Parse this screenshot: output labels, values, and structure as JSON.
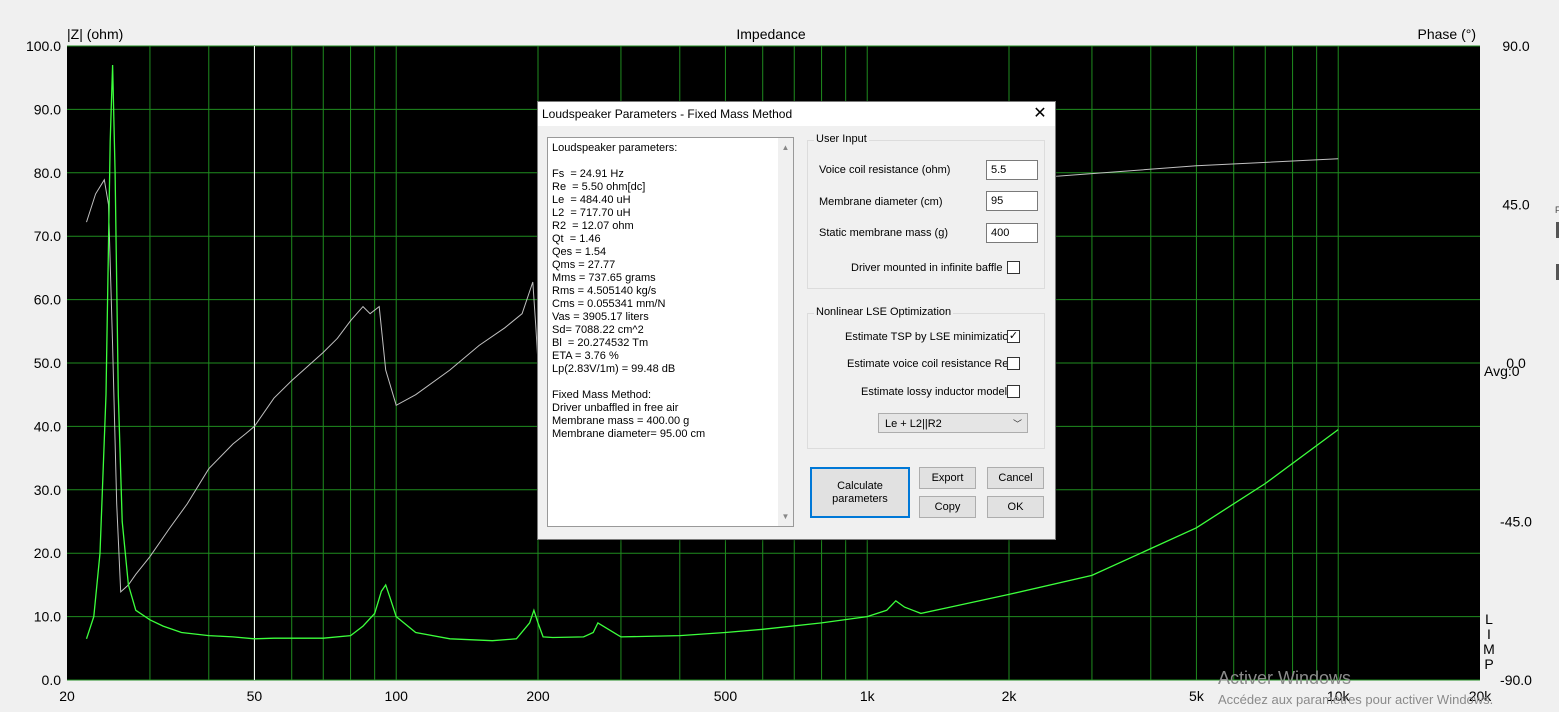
{
  "plot": {
    "title": "Impedance",
    "left_axis_label": "|Z| (ohm)",
    "right_axis_label": "Phase (°)",
    "avg_label": "Avg:0",
    "limp_label": "LIMP",
    "y_left_ticks": [
      "100.0",
      "90.0",
      "80.0",
      "70.0",
      "60.0",
      "50.0",
      "40.0",
      "30.0",
      "20.0",
      "10.0",
      "0.0"
    ],
    "y_right_ticks": [
      "90.0",
      "45.0",
      "0.0",
      "-45.0",
      "-90.0"
    ],
    "x_ticks": [
      "20",
      "50",
      "100",
      "200",
      "500",
      "1k",
      "2k",
      "5k",
      "10k",
      "20k"
    ],
    "colors": {
      "background": "#000000",
      "grid": "#1f8c1f",
      "impedance": "#3cff3c",
      "phase": "#c0c0c0",
      "cursor": "#ffffff"
    }
  },
  "chart_data": {
    "type": "line",
    "title": "Impedance",
    "xscale": "log",
    "xlim": [
      20,
      20000
    ],
    "ylim_left": [
      0,
      100
    ],
    "ylim_right": [
      -90,
      90
    ],
    "xlabel": "",
    "ylabel": "|Z| (ohm)",
    "ylabel_right": "Phase (°)",
    "grid": true,
    "series": [
      {
        "name": "|Z| (ohm)",
        "axis": "left",
        "color": "#3cff3c",
        "x": [
          22,
          22.8,
          23.5,
          24.2,
          24.7,
          25.0,
          25.3,
          25.7,
          26.2,
          27,
          28,
          30,
          32,
          35,
          40,
          45,
          50,
          55,
          60,
          70,
          80,
          85,
          90,
          93,
          95,
          97,
          100,
          110,
          130,
          160,
          180,
          192,
          196,
          200,
          205,
          215,
          250,
          262,
          268,
          300,
          400,
          500,
          600,
          800,
          1000,
          1100,
          1150,
          1200,
          1250,
          1300,
          1500,
          2000,
          3000,
          5000,
          7000,
          10000
        ],
        "y": [
          6.5,
          10,
          20,
          45,
          85,
          97,
          80,
          45,
          25,
          15,
          11,
          9.5,
          8.5,
          7.5,
          7,
          6.8,
          6.5,
          6.6,
          6.6,
          6.6,
          7,
          8.5,
          10.5,
          14,
          15,
          13,
          10,
          7.5,
          6.5,
          6.2,
          6.5,
          9,
          11,
          9,
          6.8,
          6.7,
          6.8,
          7.5,
          9,
          6.8,
          7,
          7.5,
          8,
          9,
          10,
          11,
          12.5,
          11.5,
          11,
          10.5,
          11.5,
          13.5,
          16.5,
          24,
          31,
          39.5
        ]
      },
      {
        "name": "Phase (°)",
        "axis": "right",
        "color": "#c0c0c0",
        "x": [
          22,
          23,
          24,
          24.5,
          25.0,
          25.5,
          26,
          27,
          28,
          30,
          33,
          36,
          40,
          45,
          48,
          50,
          55,
          60,
          70,
          75,
          80,
          85,
          88,
          92,
          95,
          100,
          110,
          130,
          150,
          170,
          185,
          195,
          198,
          200,
          220,
          300,
          500,
          800,
          1000,
          2000,
          5000,
          10000
        ],
        "y": [
          40,
          48,
          52,
          45,
          5,
          -40,
          -65,
          -63,
          -60,
          -55,
          -47,
          -40,
          -30,
          -23,
          -20,
          -18,
          -10,
          -5,
          3,
          7,
          12,
          16,
          14,
          16,
          -2,
          -12,
          -9,
          -2,
          5,
          10,
          14,
          23,
          10,
          0,
          -5,
          5,
          20,
          35,
          45,
          52,
          56,
          58
        ]
      }
    ],
    "cursor_x": 50
  },
  "dialog": {
    "title": "Loudspeaker Parameters - Fixed Mass Method",
    "close_label": "✕",
    "results_text": "Loudspeaker parameters:\n\nFs  = 24.91 Hz\nRe  = 5.50 ohm[dc]\nLe  = 484.40 uH\nL2  = 717.70 uH\nR2  = 12.07 ohm\nQt  = 1.46\nQes = 1.54\nQms = 27.77\nMms = 737.65 grams\nRms = 4.505140 kg/s\nCms = 0.055341 mm/N\nVas = 3905.17 liters\nSd= 7088.22 cm^2\nBl  = 20.274532 Tm\nETA = 3.76 %\nLp(2.83V/1m) = 99.48 dB\n\nFixed Mass Method:\nDriver unbaffled in free air\nMembrane mass = 400.00 g\nMembrane diameter= 95.00 cm",
    "user_input": {
      "title": "User Input",
      "voice_coil_label": "Voice coil resistance (ohm)",
      "voice_coil_value": "5.5",
      "membrane_diameter_label": "Membrane diameter (cm)",
      "membrane_diameter_value": "95",
      "static_mass_label": "Static membrane mass (g)",
      "static_mass_value": "400",
      "infinite_baffle_label": "Driver mounted in infinite baffle"
    },
    "nonlinear": {
      "title": "Nonlinear LSE Optimization",
      "estimate_tsp_label": "Estimate TSP by LSE minimization",
      "estimate_tsp_checked": "✓",
      "estimate_re_label": "Estimate voice coil resistance Re",
      "estimate_lossy_label": "Estimate lossy inductor model",
      "inductor_model_value": "Le + L2||R2"
    },
    "buttons": {
      "calculate_line1": "Calculate",
      "calculate_line2": "parameters",
      "export": "Export",
      "cancel": "Cancel",
      "copy": "Copy",
      "ok": "OK"
    }
  },
  "watermark": {
    "title": "Activer Windows",
    "subtitle": "Accédez aux paramètres pour activer Windows."
  },
  "edge_glyph": "F"
}
